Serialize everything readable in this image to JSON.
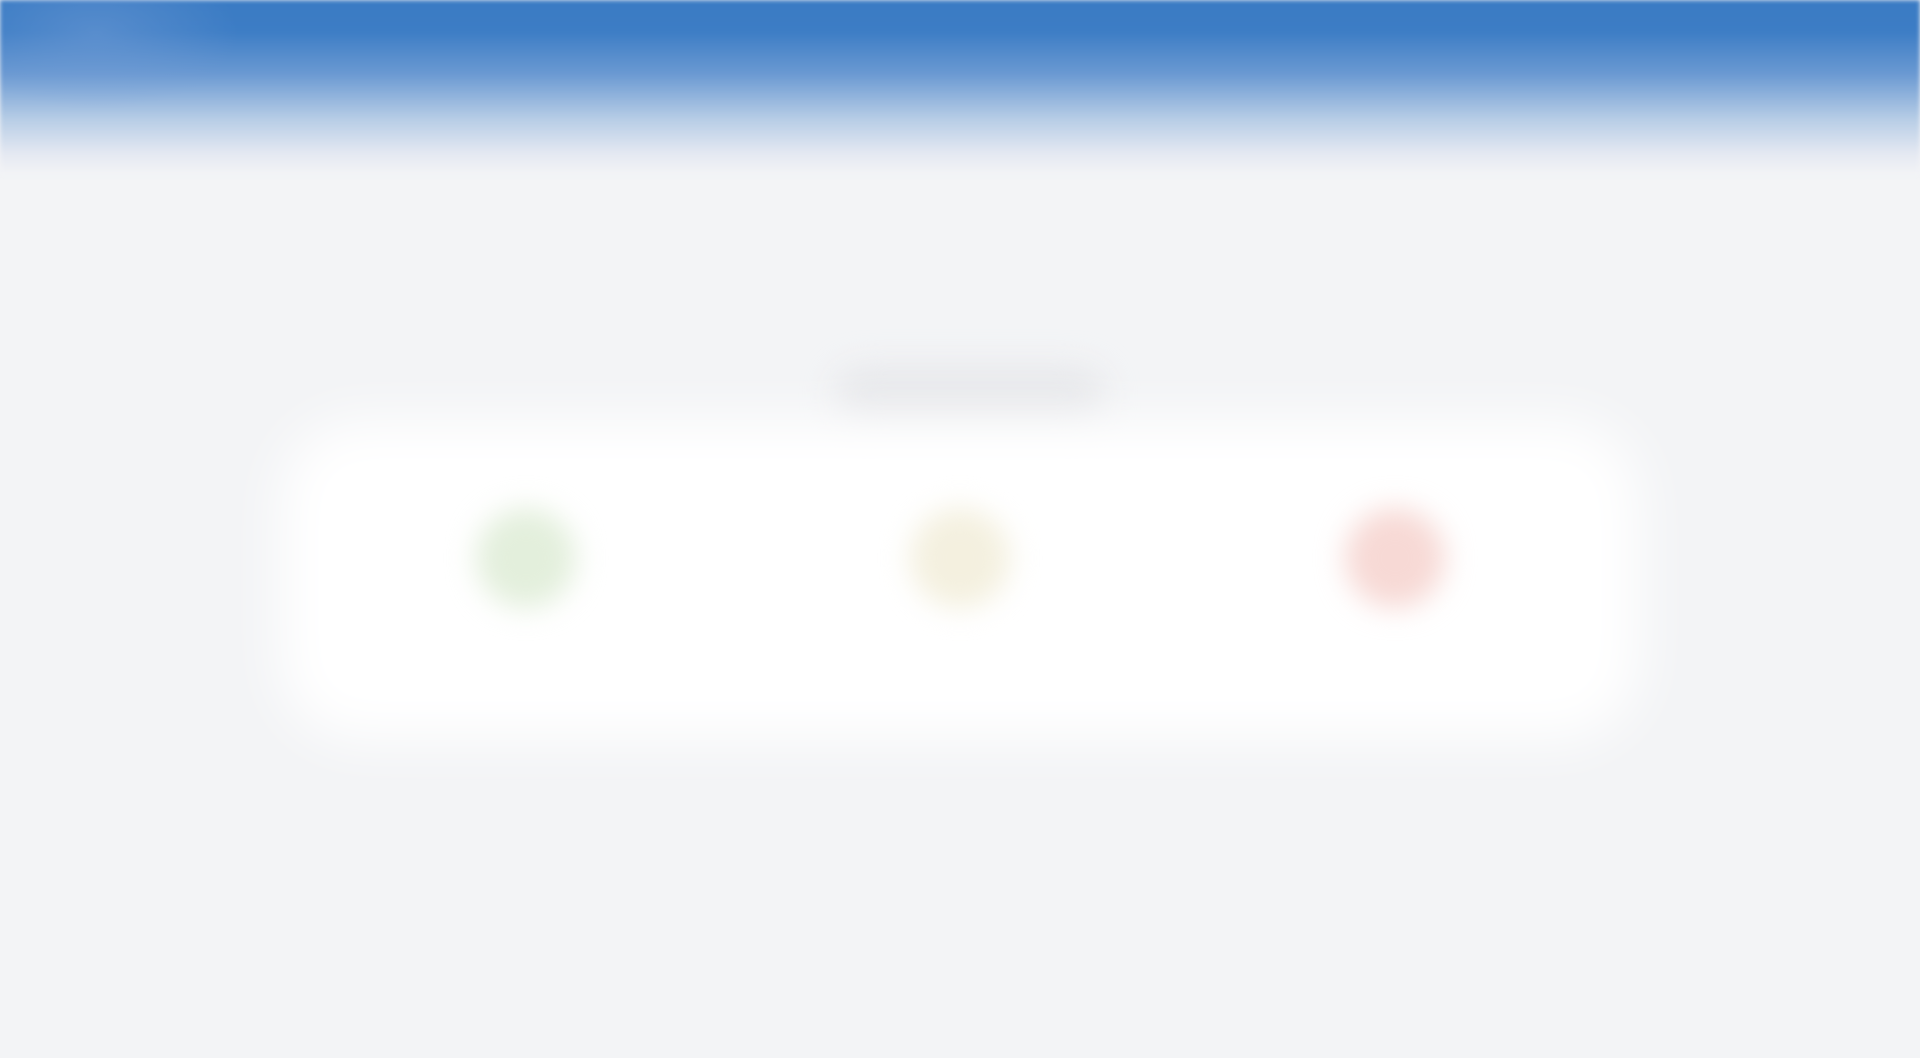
{
  "header": {
    "accent_color": "#3a7bc4"
  },
  "main": {
    "title": "",
    "cards": [
      {
        "icon": "check-circle-icon",
        "color": "#e3efdc",
        "label": ""
      },
      {
        "icon": "warning-circle-icon",
        "color": "#f4f0df",
        "label": ""
      },
      {
        "icon": "error-circle-icon",
        "color": "#f7d9d5",
        "label": ""
      }
    ]
  }
}
